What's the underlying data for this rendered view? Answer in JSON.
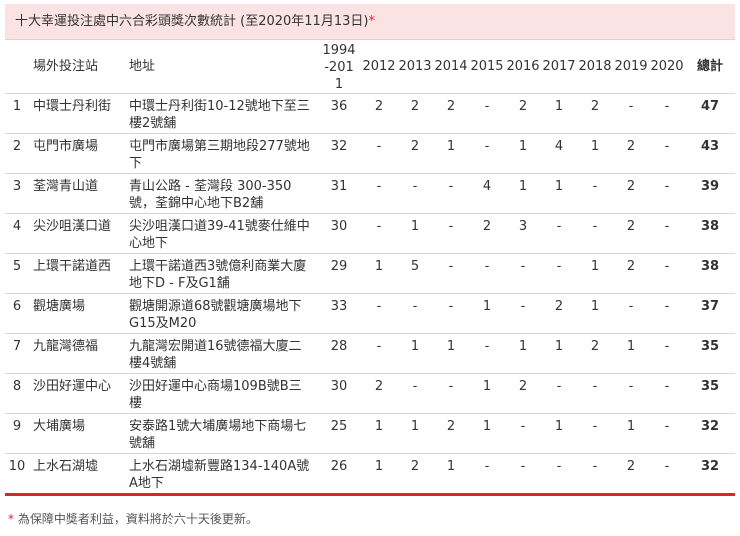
{
  "title": "十大幸運投注處中六合彩頭獎次數統計 (至2020年11月13日)",
  "title_marker": "*",
  "headers": {
    "rank": "",
    "shop": "場外投注站",
    "address": "地址",
    "years": [
      "1994-2011",
      "2012",
      "2013",
      "2014",
      "2015",
      "2016",
      "2017",
      "2018",
      "2019",
      "2020"
    ],
    "total": "總計"
  },
  "rows": [
    {
      "rank": "1",
      "shop": "中環士丹利街",
      "address": "中環士丹利街10-12號地下至三樓2號舖",
      "counts": [
        "36",
        "2",
        "2",
        "2",
        "-",
        "2",
        "1",
        "2",
        "-",
        "-"
      ],
      "total": "47"
    },
    {
      "rank": "2",
      "shop": "屯門市廣場",
      "address": "屯門市廣場第三期地段277號地下",
      "counts": [
        "32",
        "-",
        "2",
        "1",
        "-",
        "1",
        "4",
        "1",
        "2",
        "-"
      ],
      "total": "43"
    },
    {
      "rank": "3",
      "shop": "荃灣青山道",
      "address": "青山公路 - 荃灣段 300-350號，荃錦中心地下B2舖",
      "counts": [
        "31",
        "-",
        "-",
        "-",
        "4",
        "1",
        "1",
        "-",
        "2",
        "-"
      ],
      "total": "39"
    },
    {
      "rank": "4",
      "shop": "尖沙咀漢口道",
      "address": "尖沙咀漢口道39-41號麥仕維中心地下",
      "counts": [
        "30",
        "-",
        "1",
        "-",
        "2",
        "3",
        "-",
        "-",
        "2",
        "-"
      ],
      "total": "38"
    },
    {
      "rank": "5",
      "shop": "上環干諾道西",
      "address": "上環干諾道西3號億利商業大廈地下D - F及G1舖",
      "counts": [
        "29",
        "1",
        "5",
        "-",
        "-",
        "-",
        "-",
        "1",
        "2",
        "-"
      ],
      "total": "38"
    },
    {
      "rank": "6",
      "shop": "觀塘廣場",
      "address": "觀塘開源道68號觀塘廣場地下G15及M20",
      "counts": [
        "33",
        "-",
        "-",
        "-",
        "1",
        "-",
        "2",
        "1",
        "-",
        "-"
      ],
      "total": "37"
    },
    {
      "rank": "7",
      "shop": "九龍灣德福",
      "address": "九龍灣宏開道16號德福大廈二樓4號舖",
      "counts": [
        "28",
        "-",
        "1",
        "1",
        "-",
        "1",
        "1",
        "2",
        "1",
        "-"
      ],
      "total": "35"
    },
    {
      "rank": "8",
      "shop": "沙田好運中心",
      "address": "沙田好運中心商場109B號B三樓",
      "counts": [
        "30",
        "2",
        "-",
        "-",
        "1",
        "2",
        "-",
        "-",
        "-",
        "-"
      ],
      "total": "35"
    },
    {
      "rank": "9",
      "shop": "大埔廣場",
      "address": "安泰路1號大埔廣場地下商場七號舖",
      "counts": [
        "25",
        "1",
        "1",
        "2",
        "1",
        "-",
        "1",
        "-",
        "1",
        "-"
      ],
      "total": "32"
    },
    {
      "rank": "10",
      "shop": "上水石湖墟",
      "address": "上水石湖墟新豐路134-140A號A地下",
      "counts": [
        "26",
        "1",
        "2",
        "1",
        "-",
        "-",
        "-",
        "-",
        "2",
        "-"
      ],
      "total": "32"
    }
  ],
  "footnote": "為保障中獎者利益，資料將於六十天後更新。",
  "footnote_marker": "*",
  "colors": {
    "accent": "#d9232d",
    "title_bg": "#fbe3e4"
  }
}
